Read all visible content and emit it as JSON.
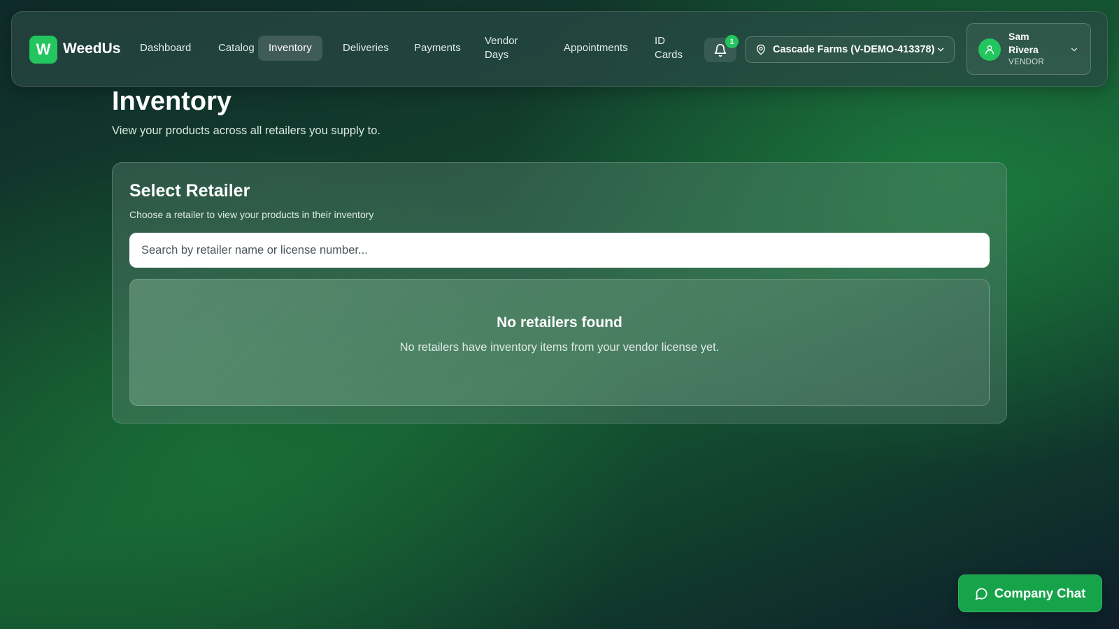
{
  "brand": {
    "logo_letter": "W",
    "name": "WeedUs",
    "accent": "#22c55e"
  },
  "nav": {
    "items": [
      {
        "label": "Dashboard",
        "active": false
      },
      {
        "label": "Catalog",
        "active": false
      },
      {
        "label": "Inventory",
        "active": true
      },
      {
        "label": "Deliveries",
        "active": false
      },
      {
        "label": "Payments",
        "active": false
      },
      {
        "label": "Vendor Days",
        "active": false
      },
      {
        "label": "Appointments",
        "active": false
      },
      {
        "label": "ID Cards",
        "active": false
      }
    ]
  },
  "notifications": {
    "icon": "bell-icon",
    "count": "1"
  },
  "location": {
    "icon": "map-pin-icon",
    "label": "Cascade Farms (V-DEMO-413378)"
  },
  "user": {
    "name": "Sam Rivera",
    "role": "VENDOR",
    "icon": "user-icon"
  },
  "page": {
    "title": "Inventory",
    "subtitle": "View your products across all retailers you supply to."
  },
  "retailer_card": {
    "title": "Select Retailer",
    "description": "Choose a retailer to view your products in their inventory",
    "search_placeholder": "Search by retailer name or license number...",
    "search_value": "",
    "empty_title": "No retailers found",
    "empty_description": "No retailers have inventory items from your vendor license yet."
  },
  "chat": {
    "label": "Company Chat",
    "icon": "chat-bubble-icon"
  }
}
